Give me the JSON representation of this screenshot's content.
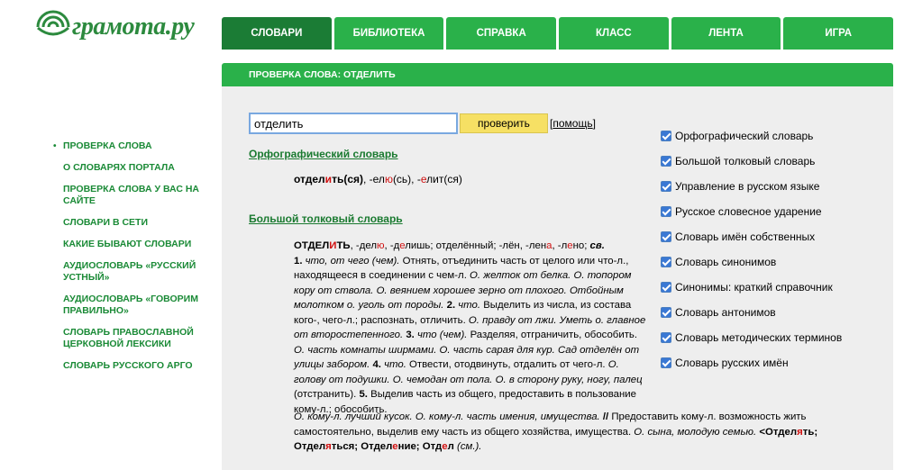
{
  "logo": {
    "text": "грамота.ру"
  },
  "nav": {
    "tabs": [
      {
        "label": "СЛОВАРИ",
        "active": true
      },
      {
        "label": "БИБЛИОТЕКА"
      },
      {
        "label": "СПРАВКА"
      },
      {
        "label": "КЛАСС"
      },
      {
        "label": "ЛЕНТА"
      },
      {
        "label": "ИГРА"
      }
    ]
  },
  "page_title": "ПРОВЕРКА СЛОВА: ОТДЕЛИТЬ",
  "sidebar": {
    "items": [
      {
        "label": "ПРОВЕРКА СЛОВА",
        "bullet": "•"
      },
      {
        "label": "О СЛОВАРЯХ ПОРТАЛА"
      },
      {
        "label": "ПРОВЕРКА СЛОВА У ВАС НА САЙТЕ"
      },
      {
        "label": "СЛОВАРИ В СЕТИ"
      },
      {
        "label": "КАКИЕ БЫВАЮТ СЛОВАРИ"
      },
      {
        "label": "АУДИОСЛОВАРЬ «РУССКИЙ УСТНЫЙ»"
      },
      {
        "label": "АУДИОСЛОВАРЬ «ГОВОРИМ ПРАВИЛЬНО»"
      },
      {
        "label": "СЛОВАРЬ ПРАВОСЛАВНОЙ ЦЕРКОВНОЙ ЛЕКСИКИ"
      },
      {
        "label": "СЛОВАРЬ РУССКОГО АРГО"
      }
    ]
  },
  "search": {
    "value": "отделить",
    "button_label": "проверить",
    "help_open": "[",
    "help_label": "помощь",
    "help_close": "]"
  },
  "ortho": {
    "heading": "Орфографический словарь",
    "w1": "отдел",
    "w2": "и",
    "w3": "ть(ся)",
    "f1": ", -ел",
    "f2": "ю",
    "f3": "(сь), -",
    "f4": "е",
    "f5": "лит(ся)"
  },
  "tolk": {
    "heading": "Большой толковый словарь",
    "hw1": "ОТДЕЛ",
    "hw2": "И",
    "hw3": "ТЬ",
    "forms1": ", -дел",
    "forms2": "ю",
    "forms3": ", -д",
    "forms4": "е",
    "forms5": "лишь; отделённый; -лён, -лен",
    "forms6": "а",
    "forms7": ", -л",
    "forms8": "е",
    "forms9": "но; ",
    "aspect": "св.",
    "s1_num": "1.",
    "s1_gram": " что, от чего (чем).",
    "s1_def": " Отнять, отъединить часть от целого или что-л., находящееся в соединении с чем-л.",
    "s1_ex": " О. желток от белка. О. топором кору от ствола. О. веянием хорошее зерно от плохого. Отбойным молотком о. уголь от породы.",
    "s2_num": " 2.",
    "s2_gram": " что.",
    "s2_def": " Выделить из числа, из состава кого-, чего-л.; распознать, отличить.",
    "s2_ex": " О. правду от лжи. Уметь о. главное от второстепенного.",
    "s3_num": " 3.",
    "s3_gram": " что (чем).",
    "s3_def": " Разделяя, отграничить, обособить.",
    "s3_ex": " О. часть комнаты ширмами. О. часть сарая для кур. Сад отделён от улицы забором.",
    "s4_num": " 4.",
    "s4_gram": " что.",
    "s4_def": " Отвести, отодвинуть, отдалить от чего-л.",
    "s4_ex": " О. голову от подушки. О. чемодан от пола. О. в сторону руку, ногу, палец",
    "s4_tail": " (отстранить).",
    "s5_num": " 5.",
    "s5_def": " Выделив часть из общего, предоставить в пользование кому-л.; обособить.",
    "wide_ex": "О. кому-л. лучший кусок. О. кому-л. часть имения, имущества.",
    "sep": " // ",
    "wide_def": "Предоставить кому-л. возможность жить самостоятельно, выделив ему часть из общего хозяйства, имущества.",
    "wide_ex2": " О. сына, молодую семью. ",
    "rel1": "<Отдел",
    "rel2": "я",
    "rel3": "ть;",
    "rel4": "Отдел",
    "rel5": "я",
    "rel6": "ться; ",
    "rel7": "Отдел",
    "rel8": "е",
    "rel9": "ние; ",
    "rel10": "Отд",
    "rel11": "е",
    "rel12": "л",
    "rel13": " (см.)."
  },
  "checklist": {
    "items": [
      "Орфографический словарь",
      "Большой толковый словарь",
      "Управление в русском языке",
      "Русское словесное ударение",
      "Словарь имён собственных",
      "Словарь синонимов",
      "Синонимы: краткий справочник",
      "Словарь антонимов",
      "Словарь методических терминов",
      "Словарь русских имён"
    ]
  },
  "colors": {
    "green": "#2ab14a",
    "dark_green": "#1b7c35",
    "link_green": "#1a8a36",
    "stress_red": "#d01010",
    "panel_grey": "#eeeeee",
    "button_yellow": "#f6e064"
  }
}
